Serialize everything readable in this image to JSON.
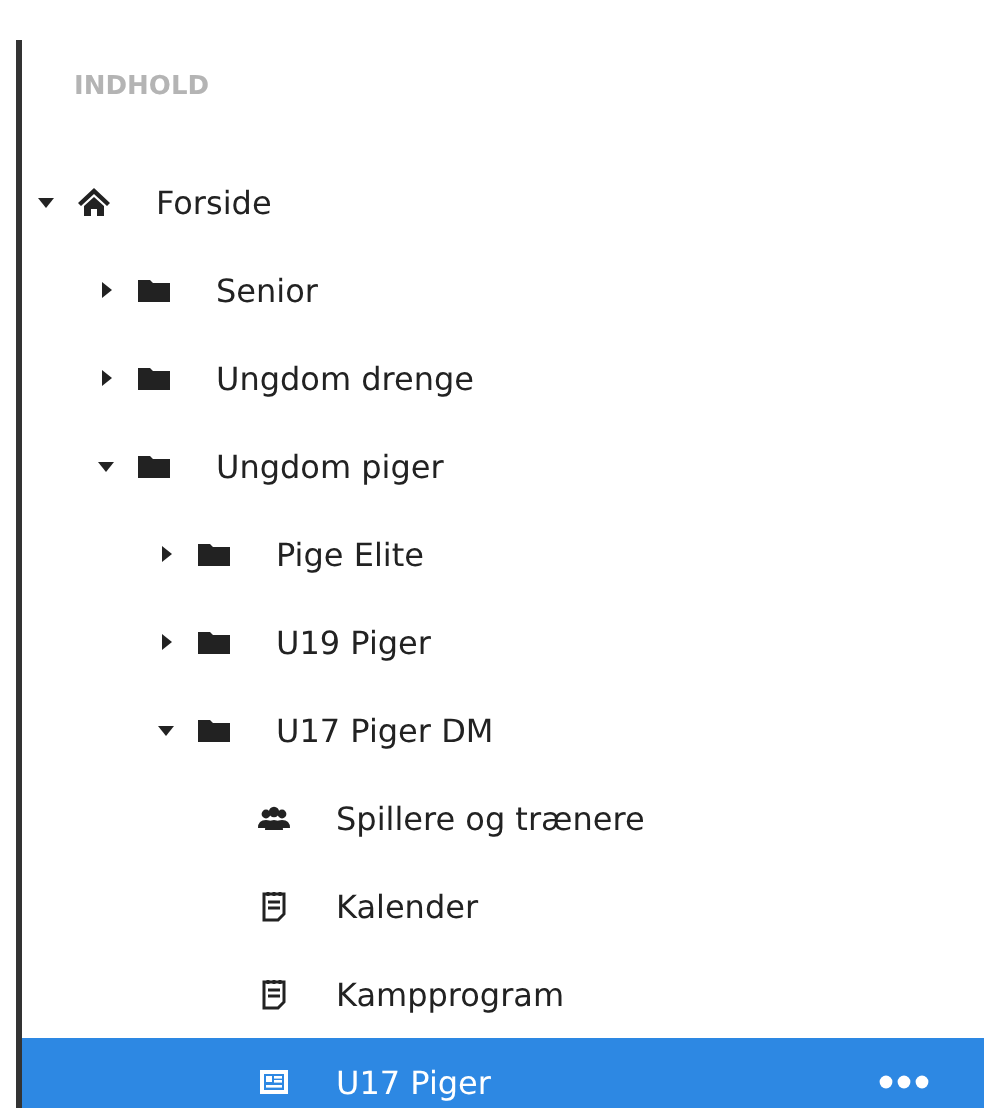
{
  "header": "INDHOLD",
  "tree": [
    {
      "label": "Forside",
      "kind": "home",
      "expanded": true,
      "selected": false,
      "children": [
        {
          "label": "Senior",
          "kind": "folder",
          "expanded": false,
          "selected": false
        },
        {
          "label": "Ungdom drenge",
          "kind": "folder",
          "expanded": false,
          "selected": false
        },
        {
          "label": "Ungdom piger",
          "kind": "folder",
          "expanded": true,
          "selected": false,
          "children": [
            {
              "label": "Pige Elite",
              "kind": "folder",
              "expanded": false,
              "selected": false
            },
            {
              "label": "U19 Piger",
              "kind": "folder",
              "expanded": false,
              "selected": false
            },
            {
              "label": "U17 Piger DM",
              "kind": "folder",
              "expanded": true,
              "selected": false,
              "children": [
                {
                  "label": "Spillere og trænere",
                  "kind": "people",
                  "selected": false
                },
                {
                  "label": "Kalender",
                  "kind": "note",
                  "selected": false
                },
                {
                  "label": "Kampprogram",
                  "kind": "note",
                  "selected": false
                },
                {
                  "label": "U17 Piger",
                  "kind": "page",
                  "selected": true
                }
              ]
            }
          ]
        }
      ]
    }
  ]
}
